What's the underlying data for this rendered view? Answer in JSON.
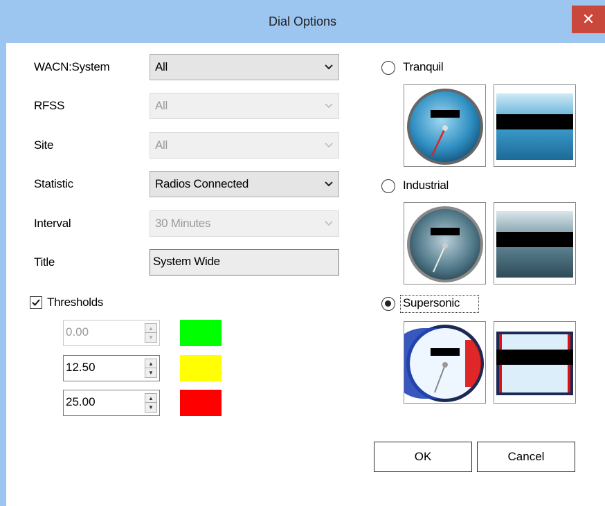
{
  "window": {
    "title": "Dial Options",
    "close_glyph": "✕"
  },
  "form": {
    "wacn_label": "WACN:System",
    "wacn_value": "All",
    "rfss_label": "RFSS",
    "rfss_value": "All",
    "site_label": "Site",
    "site_value": "All",
    "statistic_label": "Statistic",
    "statistic_value": "Radios Connected",
    "interval_label": "Interval",
    "interval_value": "30 Minutes",
    "title_label": "Title",
    "title_value": "System Wide"
  },
  "thresholds": {
    "label": "Thresholds",
    "checked": true,
    "rows": [
      {
        "value": "0.00",
        "color": "#00ff00",
        "enabled": false
      },
      {
        "value": "12.50",
        "color": "#ffff00",
        "enabled": true
      },
      {
        "value": "25.00",
        "color": "#ff0000",
        "enabled": true
      }
    ]
  },
  "styles": {
    "options": [
      {
        "label": "Tranquil",
        "selected": false
      },
      {
        "label": "Industrial",
        "selected": false
      },
      {
        "label": "Supersonic",
        "selected": true
      }
    ]
  },
  "buttons": {
    "ok": "OK",
    "cancel": "Cancel"
  },
  "colors": {
    "titlebar": "#9cc5f0",
    "close": "#c9473b"
  }
}
